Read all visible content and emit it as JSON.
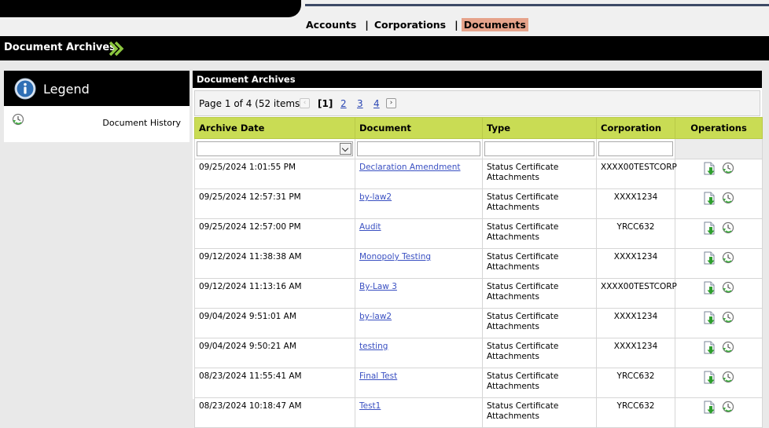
{
  "nav": {
    "items": [
      {
        "label": "Accounts",
        "active": false
      },
      {
        "label": "Corporations",
        "active": false
      },
      {
        "label": "Documents",
        "active": true
      }
    ],
    "separator": "|"
  },
  "page": {
    "title": "Document Archives",
    "title_icon": "double-chevron-right-icon"
  },
  "legend": {
    "title": "Legend",
    "icon": "info-icon",
    "items": [
      {
        "icon": "history-icon",
        "label": "Document History"
      }
    ]
  },
  "archives": {
    "header": "Document Archives",
    "pager": {
      "info": "Page 1 of 4 (52 items)",
      "current": "[1]",
      "pages": [
        "2",
        "3",
        "4"
      ],
      "prev_icon": "chevron-left-icon",
      "next_icon": "chevron-right-icon"
    },
    "columns": [
      "Archive Date",
      "Document",
      "Type",
      "Corporation",
      "Operations"
    ],
    "filter_icon": "dropdown-icon",
    "row_icons": [
      "download-icon",
      "history-icon"
    ],
    "rows": [
      {
        "date": "09/25/2024 1:01:55 PM",
        "document": "Declaration Amendment",
        "type": "Status Certificate Attachments",
        "corporation": "XXXX00TESTCORP"
      },
      {
        "date": "09/25/2024 12:57:31 PM",
        "document": "by-law2",
        "type": "Status Certificate Attachments",
        "corporation": "XXXX1234"
      },
      {
        "date": "09/25/2024 12:57:00 PM",
        "document": "Audit",
        "type": "Status Certificate Attachments",
        "corporation": "YRCC632"
      },
      {
        "date": "09/12/2024 11:38:38 AM",
        "document": "Monopoly Testing",
        "type": "Status Certificate Attachments",
        "corporation": "XXXX1234"
      },
      {
        "date": "09/12/2024 11:13:16 AM",
        "document": "By-Law 3",
        "type": "Status Certificate Attachments",
        "corporation": "XXXX00TESTCORP"
      },
      {
        "date": "09/04/2024 9:51:01 AM",
        "document": "by-law2",
        "type": "Status Certificate Attachments",
        "corporation": "XXXX1234"
      },
      {
        "date": "09/04/2024 9:50:21 AM",
        "document": "testing",
        "type": "Status Certificate Attachments",
        "corporation": "XXXX1234"
      },
      {
        "date": "08/23/2024 11:55:41 AM",
        "document": "Final Test",
        "type": "Status Certificate Attachments",
        "corporation": "YRCC632"
      },
      {
        "date": "08/23/2024 10:18:47 AM",
        "document": "Test1",
        "type": "Status Certificate Attachments",
        "corporation": "YRCC632"
      }
    ]
  },
  "colors": {
    "header_green": "#c9dc54",
    "active_nav": "#e6a38b",
    "chevron_green": "#8cc63f",
    "link_blue": "#3a50c2"
  }
}
